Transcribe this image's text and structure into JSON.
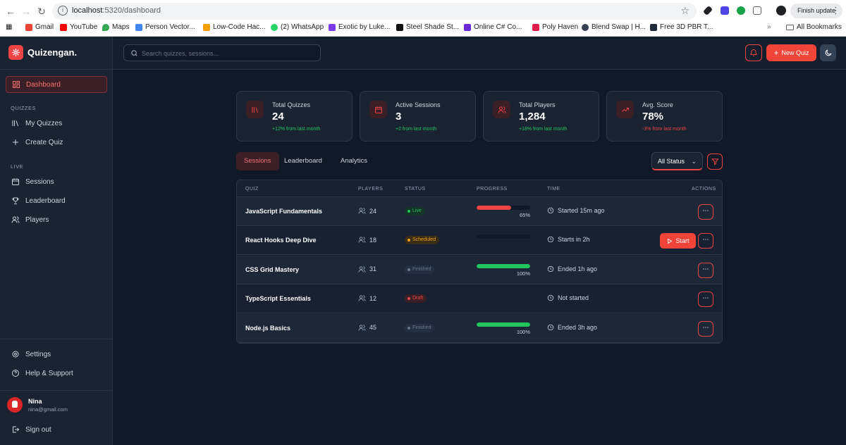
{
  "browser": {
    "url_host": "localhost",
    "url_path": ":5320/dashboard",
    "finish_update": "Finish update",
    "bookmarks": [
      {
        "label": "Gmail",
        "color": "#ea4335"
      },
      {
        "label": "YouTube",
        "color": "#ff0000"
      },
      {
        "label": "Maps",
        "color": "#34a853"
      },
      {
        "label": "Person Vector...",
        "color": "#4285f4"
      },
      {
        "label": "Low-Code Hac...",
        "color": "#f59e0b"
      },
      {
        "label": "(2) WhatsApp",
        "color": "#25d366"
      },
      {
        "label": "Exotic by Luke...",
        "color": "#7c3aed"
      },
      {
        "label": "Steel Shade St...",
        "color": "#111111"
      },
      {
        "label": "Online C# Co...",
        "color": "#6d28d9"
      },
      {
        "label": "Poly Haven",
        "color": "#e11d48"
      },
      {
        "label": "Blend Swap | H...",
        "color": "#374151"
      },
      {
        "label": "Free 3D PBR T...",
        "color": "#1f2937"
      }
    ],
    "all_bookmarks": "All Bookmarks"
  },
  "app": {
    "brand": "Quizengan.",
    "search_placeholder": "Search quizzes, sessions...",
    "new_quiz": "New Quiz"
  },
  "sidebar": {
    "dashboard": "Dashboard",
    "section_quizzes": "QUIZZES",
    "my_quizzes": "My Quizzes",
    "create_quiz": "Create Quiz",
    "section_live": "LIVE",
    "sessions": "Sessions",
    "leaderboard": "Leaderboard",
    "players": "Players",
    "settings": "Settings",
    "help": "Help & Support",
    "user_name": "Nina",
    "user_email": "nina@gmail.com",
    "sign_out": "Sign out"
  },
  "stats": [
    {
      "label": "Total Quizzes",
      "value": "24",
      "change": "+12% from last month",
      "icon": "library-icon"
    },
    {
      "label": "Active Sessions",
      "value": "3",
      "change": "+2 from last month",
      "icon": "calendar-icon"
    },
    {
      "label": "Total Players",
      "value": "1,284",
      "change": "+18% from last month",
      "icon": "users-icon"
    },
    {
      "label": "Avg. Score",
      "value": "78%",
      "change": "-3% from last month",
      "icon": "trending-up-icon"
    }
  ],
  "tabs": [
    "Sessions",
    "Leaderboard",
    "Analytics"
  ],
  "status_filter": "All Status",
  "table": {
    "headers": [
      "QUIZ",
      "PLAYERS",
      "STATUS",
      "PROGRESS",
      "TIME",
      "ACTIONS"
    ],
    "rows": [
      {
        "quiz": "JavaScript Fundamentals",
        "players": "24",
        "status": "Live",
        "status_fg": "#22c55e",
        "status_bg": "#14342a",
        "progress": 0.65,
        "progress_label": "65%",
        "progress_color": "#ef4444",
        "time": "Started 15m ago",
        "start": ""
      },
      {
        "quiz": "React Hooks Deep Dive",
        "players": "18",
        "status": "Scheduled",
        "status_fg": "#f59e0b",
        "status_bg": "#3a2d17",
        "progress": 0,
        "progress_label": "",
        "progress_color": "",
        "time": "Starts in 2h",
        "start": "Start"
      },
      {
        "quiz": "CSS Grid Mastery",
        "players": "31",
        "status": "Finished",
        "status_fg": "#64748b",
        "status_bg": "#243042",
        "progress": 1,
        "progress_label": "100%",
        "progress_color": "#22c55e",
        "time": "Ended 1h ago",
        "start": ""
      },
      {
        "quiz": "TypeScript Essentials",
        "players": "12",
        "status": "Draft",
        "status_fg": "#ef4444",
        "status_bg": "#3a1f27",
        "progress": null,
        "progress_label": "",
        "progress_color": "",
        "time": "Not started",
        "start": ""
      },
      {
        "quiz": "Node.js Basics",
        "players": "45",
        "status": "Finished",
        "status_fg": "#64748b",
        "status_bg": "#243042",
        "progress": 1,
        "progress_label": "100%",
        "progress_color": "#22c55e",
        "time": "Ended 3h ago",
        "start": ""
      }
    ]
  }
}
